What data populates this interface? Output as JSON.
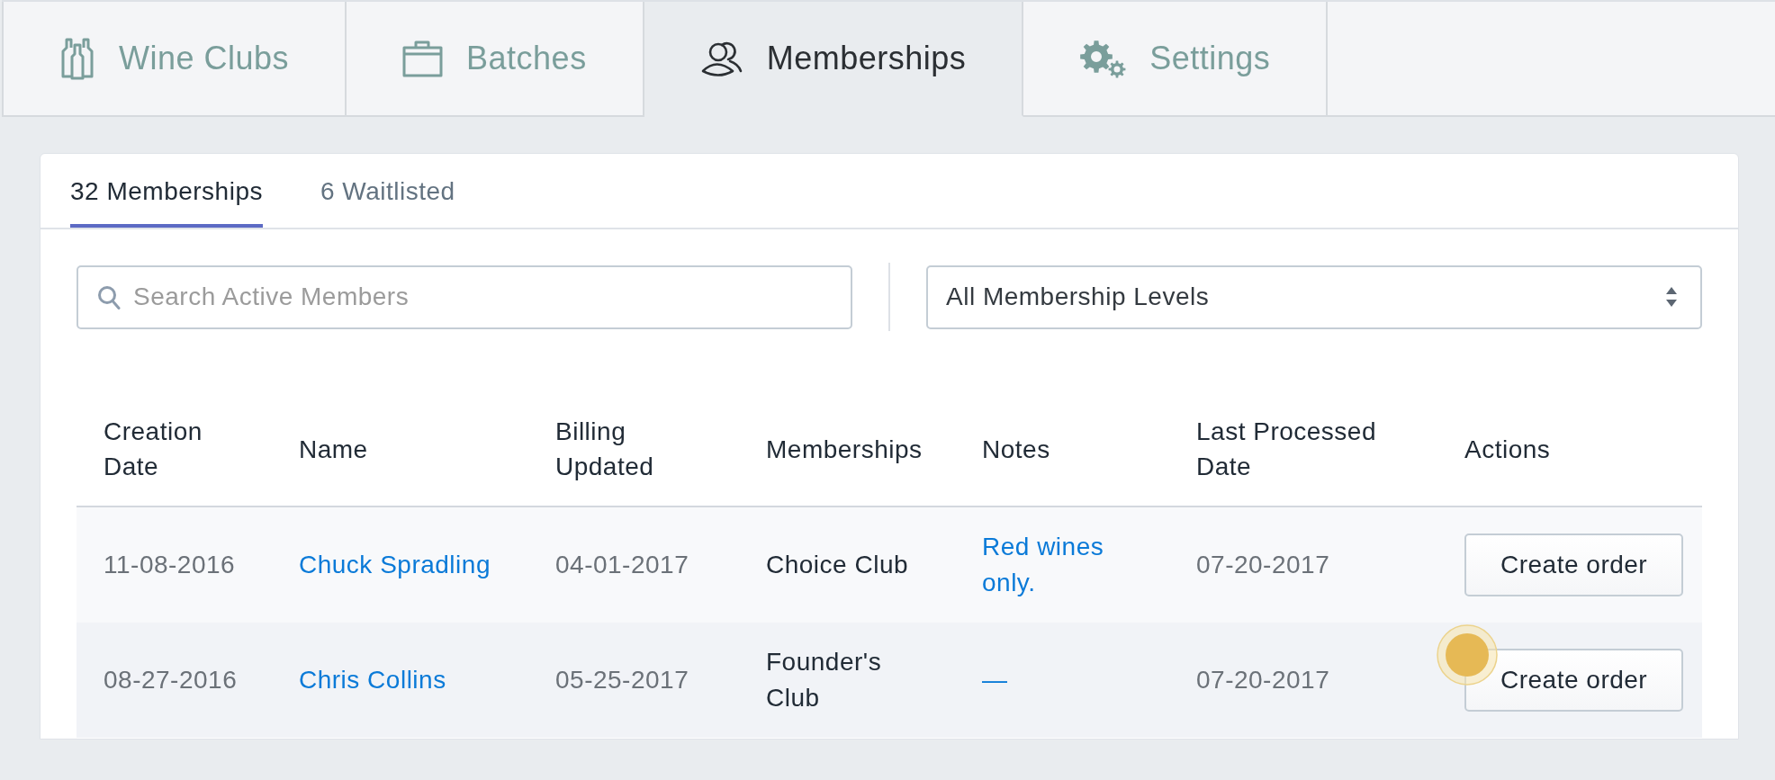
{
  "tabs": [
    {
      "label": "Wine Clubs",
      "selected": false
    },
    {
      "label": "Batches",
      "selected": false
    },
    {
      "label": "Memberships",
      "selected": true
    },
    {
      "label": "Settings",
      "selected": false
    }
  ],
  "subtabs": [
    {
      "label": "32 Memberships",
      "selected": true
    },
    {
      "label": "6 Waitlisted",
      "selected": false
    }
  ],
  "search": {
    "placeholder": "Search Active Members"
  },
  "level_select": {
    "value": "All Membership Levels"
  },
  "table": {
    "columns": [
      "Creation Date",
      "Name",
      "Billing Updated",
      "Memberships",
      "Notes",
      "Last Processed Date",
      "Actions"
    ],
    "rows": [
      {
        "creation_date": "11-08-2016",
        "name": "Chuck Spradling",
        "billing_updated": "04-01-2017",
        "memberships": "Choice Club",
        "notes": "Red wines only.",
        "last_processed_date": "07-20-2017",
        "action": "Create order"
      },
      {
        "creation_date": "08-27-2016",
        "name": "Chris Collins",
        "billing_updated": "05-25-2017",
        "memberships": "Founder's Club",
        "notes": "—",
        "last_processed_date": "07-20-2017",
        "action": "Create order"
      }
    ]
  }
}
